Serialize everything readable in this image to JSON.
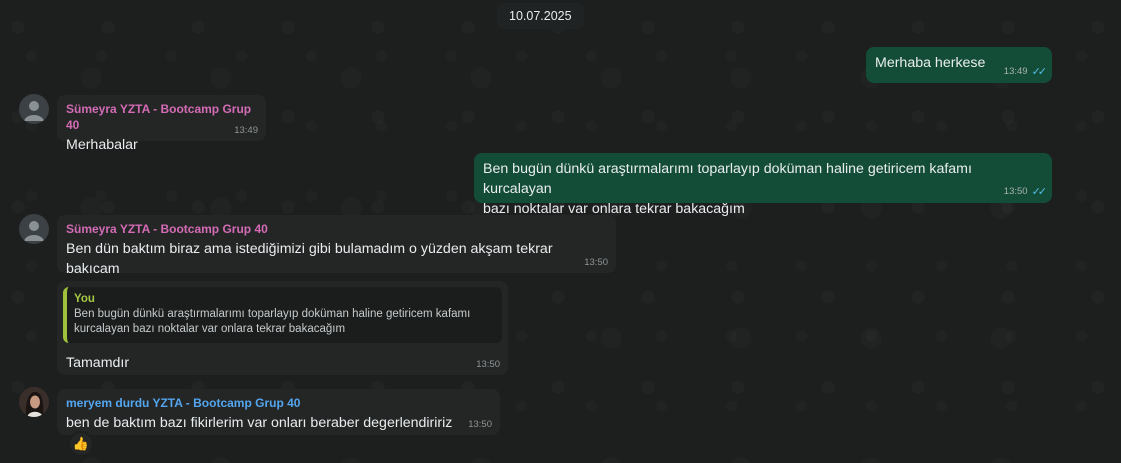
{
  "date_chip": "10.07.2025",
  "messages": [
    {
      "type": "out",
      "text": "Merhaba herkese",
      "time": "13:49"
    },
    {
      "type": "in",
      "sender": "Sümeyra YZTA - Bootcamp Grup 40",
      "sender_color": "#d36bb5",
      "text": "Merhabalar",
      "time": "13:49"
    },
    {
      "type": "out",
      "text_line1": "Ben bugün dünkü araştırmalarımı toparlayıp doküman haline getiricem kafamı kurcalayan",
      "text_line2": "bazı noktalar var onlara tekrar bakacağım",
      "time": "13:50"
    },
    {
      "type": "in",
      "sender": "Sümeyra YZTA - Bootcamp Grup 40",
      "sender_color": "#d36bb5",
      "text": "Ben dün baktım biraz ama istediğimizi gibi bulamadım o yüzden akşam tekrar bakıcam",
      "time": "13:50"
    },
    {
      "type": "in-reply",
      "quote_author": "You",
      "quote_line1": "Ben bugün dünkü araştırmalarımı toparlayıp doküman haline getiricem kafamı",
      "quote_line2": "kurcalayan bazı noktalar var onlara tekrar bakacağım",
      "text": "Tamamdır",
      "time": "13:50"
    },
    {
      "type": "in",
      "sender": "meryem durdu YZTA - Bootcamp Grup 40",
      "sender_color": "#53a6f0",
      "text": "ben de baktım bazı fikirlerim var onları beraber degerlendiririz",
      "time": "13:50",
      "reaction": "👍"
    }
  ],
  "colors": {
    "outgoing": "#144d37",
    "incoming": "#242626",
    "read_ticks": "#53bdeb"
  }
}
